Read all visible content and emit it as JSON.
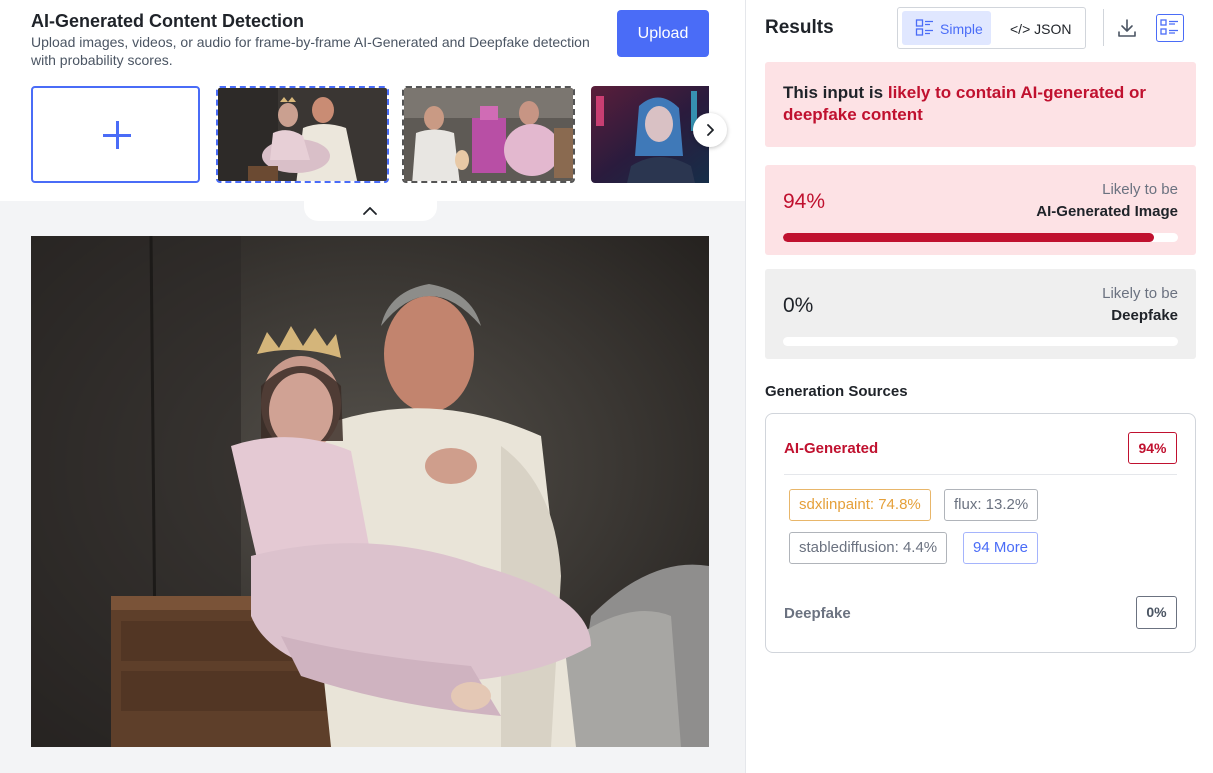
{
  "header": {
    "title": "AI-Generated Content Detection",
    "subtitle": "Upload images, videos, or audio for frame-by-frame AI-Generated and Deepfake detection with probability scores.",
    "upload_label": "Upload"
  },
  "thumbnails": [
    {
      "name": "thumb-1",
      "selected": true
    },
    {
      "name": "thumb-2",
      "selected": false
    },
    {
      "name": "thumb-3",
      "selected": false
    }
  ],
  "icons": {
    "add": "plus-icon",
    "next": "chevron-right-icon",
    "collapse": "chevron-up-icon",
    "simple": "list-layout-icon",
    "download": "download-icon",
    "details": "details-list-icon"
  },
  "results": {
    "title": "Results",
    "toggle": {
      "simple_label": "Simple",
      "json_label": "</> JSON",
      "active": "Simple"
    },
    "verdict": {
      "prefix": "This input is ",
      "highlight": "likely to contain AI-generated or deepfake content"
    },
    "ai_card": {
      "percent_label": "94%",
      "percent": 94,
      "likely": "Likely to be",
      "kind": "AI-Generated Image"
    },
    "deepfake_card": {
      "percent_label": "0%",
      "percent": 0,
      "likely": "Likely to be",
      "kind": "Deepfake"
    },
    "sources_title": "Generation Sources",
    "sources": {
      "ai_label": "AI-Generated",
      "ai_badge": "94%",
      "tags": [
        "sdxlinpaint: 74.8%",
        "flux: 13.2%",
        "stablediffusion: 4.4%",
        "94 More"
      ],
      "deepfake_label": "Deepfake",
      "deepfake_badge": "0%"
    }
  },
  "colors": {
    "accent": "#4a6cf7",
    "danger": "#c0112f",
    "danger_bg": "#fde2e5",
    "neutral_bg": "#efefef",
    "highlight_tag": "#e5a03a"
  }
}
